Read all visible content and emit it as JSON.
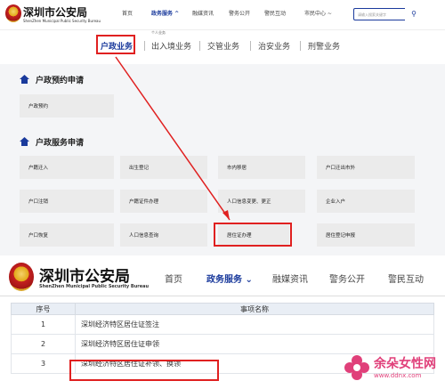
{
  "screenshot1": {
    "logo": {
      "title": "深圳市公安局",
      "subtitle": "ShenZhen Municipal Public Security Bureau"
    },
    "nav": [
      {
        "label": "首页"
      },
      {
        "label": "政务服务 ^",
        "active": true
      },
      {
        "label": "融媒资讯"
      },
      {
        "label": "警务公开"
      },
      {
        "label": "警民互动"
      },
      {
        "label": "市民中心 ~"
      }
    ],
    "search": {
      "placeholder": "请输入搜索关键字",
      "icon": "search-icon"
    },
    "tooltip": "个人业务",
    "subnav": [
      "户政业务",
      "出入境业务",
      "交管业务",
      "治安业务",
      "刑警业务"
    ],
    "section1": {
      "title": "户政预约申请",
      "cards": [
        "户政预约"
      ]
    },
    "section2": {
      "title": "户政服务申请",
      "cards": [
        "户籍迁入",
        "出生登记",
        "市内移居",
        "户口迁出市外",
        "户口注销",
        "户籍证件办理",
        "人口信息变更、更正",
        "企业入户",
        "户口恢复",
        "人口信息查询",
        "居住证办理",
        "居住登记申报"
      ]
    }
  },
  "screenshot2": {
    "logo": {
      "title": "深圳市公安局",
      "subtitle": "ShenZhen Municipal Public Security Bureau"
    },
    "nav": [
      {
        "label": "首页"
      },
      {
        "label": "政务服务 ⌄",
        "active": true
      },
      {
        "label": "融媒资讯"
      },
      {
        "label": "警务公开"
      },
      {
        "label": "警民互动"
      }
    ],
    "table": {
      "headers": [
        "序号",
        "事项名称"
      ],
      "rows": [
        {
          "no": "1",
          "name": "深圳经济特区居住证签注"
        },
        {
          "no": "2",
          "name": "深圳经济特区居住证申领"
        },
        {
          "no": "3",
          "name": "深圳经济特区居住证补领、换领"
        }
      ]
    }
  },
  "watermark": {
    "title": "余朵女性网",
    "url": "www.ddnx.com"
  },
  "colors": {
    "accent": "#1a3a9c",
    "highlight": "#e02020",
    "card": "#ebebeb",
    "watermark": "#e0407a"
  }
}
